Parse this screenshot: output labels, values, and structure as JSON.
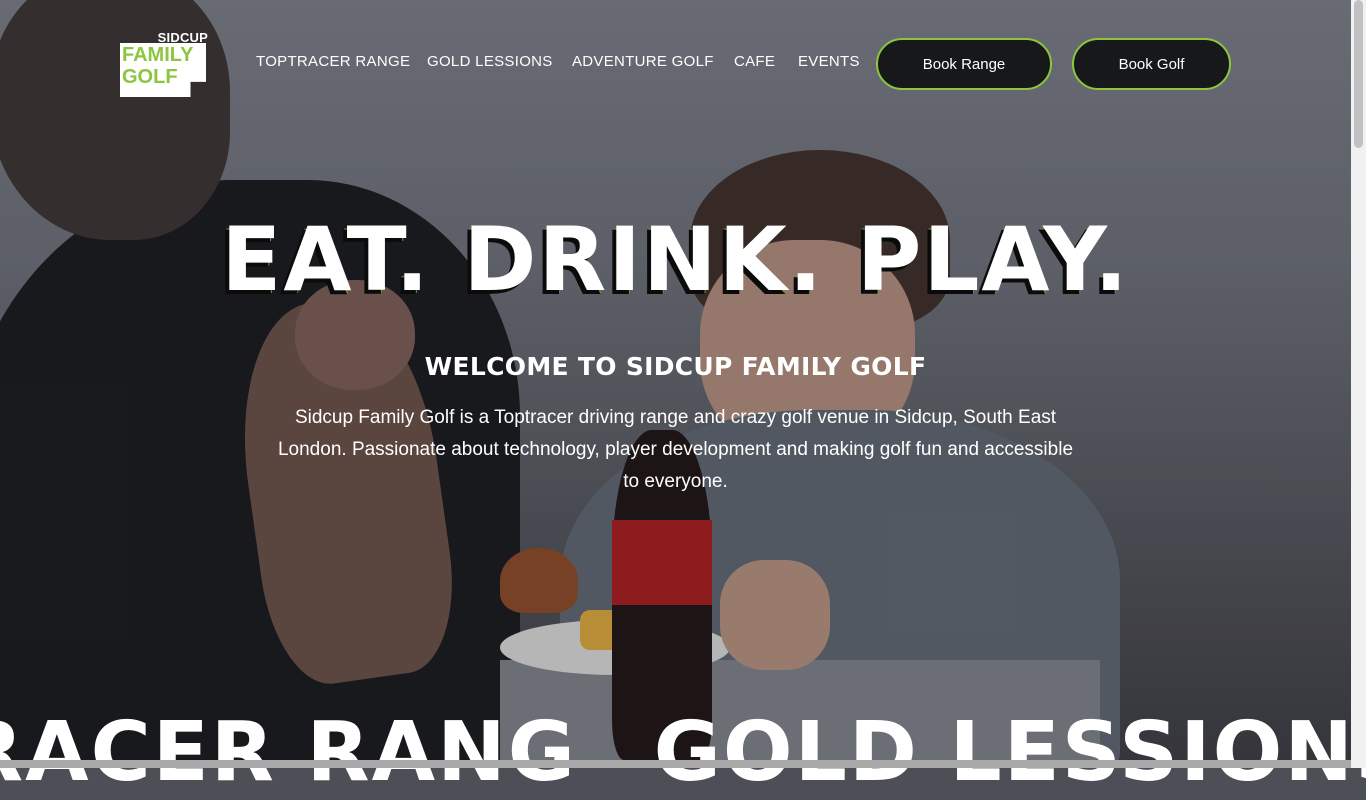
{
  "header": {
    "logo": {
      "top": "SIDCUP",
      "line1": "FAMILY",
      "line2": "GOLF"
    },
    "nav": [
      "TOPTRACER RANGE",
      "GOLD LESSIONS",
      "ADVENTURE GOLF",
      "CAFE",
      "EVENTS"
    ],
    "book_range_label": "Book Range",
    "book_golf_label": "Book Golf"
  },
  "hero": {
    "headline": "EAT. DRINK. PLAY.",
    "welcome": "WELCOME TO SIDCUP FAMILY GOLF",
    "description": "Sidcup Family Golf is a Toptracer driving range and crazy golf venue in Sidcup, South East London. Passionate about technology, player development and making golf fun and accessible to everyone."
  },
  "marquee": [
    "RACER RANG",
    "GOLD LESSIONS"
  ],
  "colors": {
    "accent": "#8cc63f",
    "button_bg": "#16181a",
    "text": "#ffffff"
  }
}
